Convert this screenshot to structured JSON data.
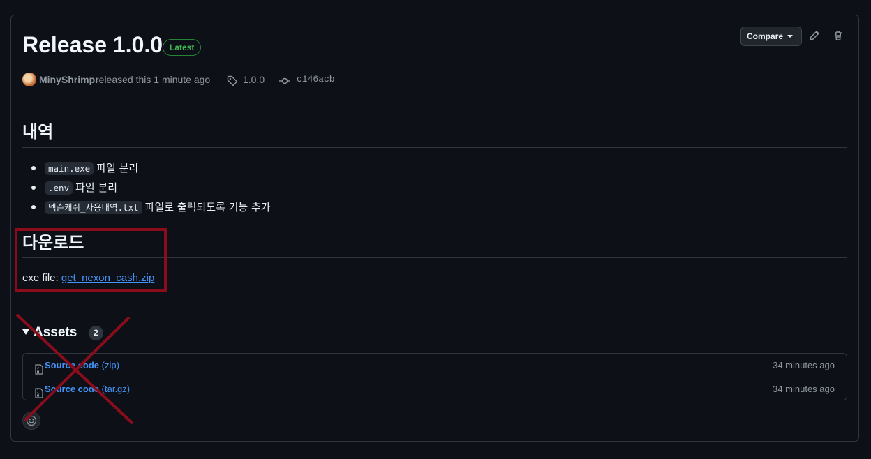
{
  "release": {
    "title": "Release 1.0.0",
    "badge": "Latest",
    "author": "MinyShrimp",
    "released_text": "released this 1 minute ago",
    "tag": "1.0.0",
    "commit": "c146acb"
  },
  "toolbar": {
    "compare_label": "Compare",
    "edit_icon": "pencil-icon",
    "delete_icon": "trash-icon"
  },
  "body": {
    "section1_title": "내역",
    "notes": [
      {
        "code": "main.exe",
        "text": "파일 분리"
      },
      {
        "code": ".env",
        "text": "파일 분리"
      },
      {
        "code": "넥슨캐쉬_사용내역.txt",
        "text": "파일로 출력되도록 기능 추가"
      }
    ],
    "section2_title": "다운로드",
    "exe_label": "exe file: ",
    "exe_link": "get_nexon_cash.zip"
  },
  "assets": {
    "title": "Assets",
    "count": "2",
    "items": [
      {
        "name": "Source code",
        "format": "(zip)",
        "time": "34 minutes ago"
      },
      {
        "name": "Source code",
        "format": "(tar.gz)",
        "time": "34 minutes ago"
      }
    ]
  },
  "colors": {
    "annotation": "#8b0c1b",
    "link": "#4493f8",
    "badge": "#3fb950"
  }
}
